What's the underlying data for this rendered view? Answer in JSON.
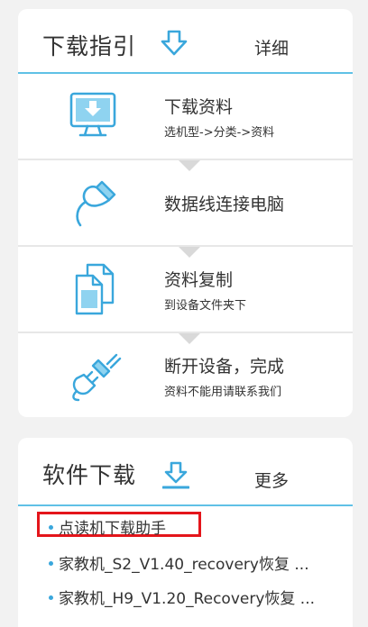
{
  "guide": {
    "title": "下载指引",
    "more_label": "详细",
    "steps": [
      {
        "title": "下载资料",
        "subtitle": "选机型->分类->资料",
        "icon": "monitor-download-icon"
      },
      {
        "title": "数据线连接电脑",
        "subtitle": "",
        "icon": "usb-cable-icon"
      },
      {
        "title": "资料复制",
        "subtitle": "到设备文件夹下",
        "icon": "copy-documents-icon"
      },
      {
        "title": "断开设备，完成",
        "subtitle": "资料不能用请联系我们",
        "icon": "unplug-icon"
      }
    ]
  },
  "software": {
    "title": "软件下载",
    "more_label": "更多",
    "items": [
      {
        "label": "点读机下载助手",
        "highlighted": true
      },
      {
        "label": "家教机_S2_V1.40_recovery恢复 ..."
      },
      {
        "label": "家教机_H9_V1.20_Recovery恢复 ..."
      }
    ]
  },
  "colors": {
    "accent": "#3aa7dc",
    "divider_accent": "#5fc1e6",
    "highlight_border": "#e4151b"
  }
}
